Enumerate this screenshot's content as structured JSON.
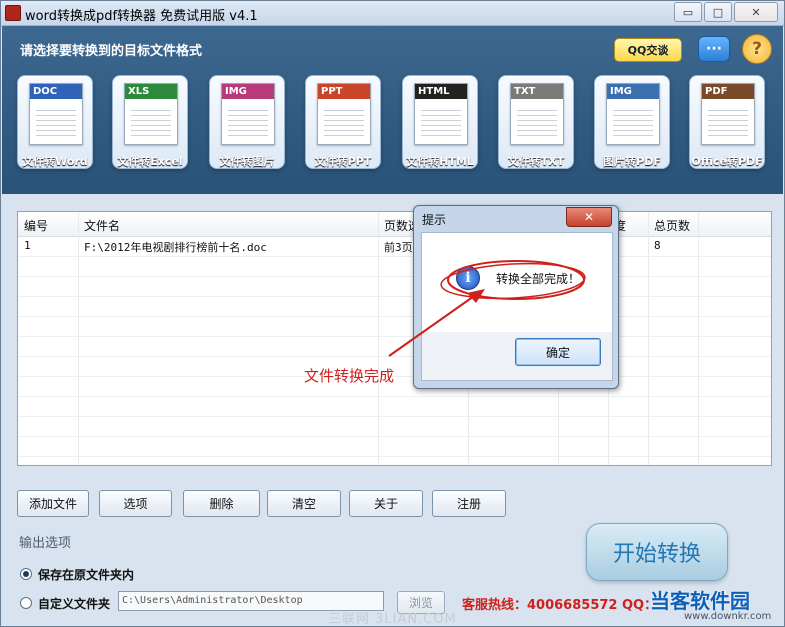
{
  "window": {
    "title": "word转换成pdf转换器 免费试用版 v4.1",
    "minimize_glyph": "▭",
    "maximize_glyph": "□",
    "close_glyph": "✕"
  },
  "top_panel": {
    "heading": "请选择要转换到的目标文件格式",
    "qq_label": "QQ交谈",
    "chat_glyph": "···",
    "help_glyph": "?"
  },
  "tools": [
    {
      "tag": "DOC",
      "label": "文件转Word",
      "icon": "word-doc-icon",
      "color": "#2f62b8"
    },
    {
      "tag": "XLS",
      "label": "文件转Excel",
      "icon": "excel-chart-icon",
      "color": "#2d8a3c"
    },
    {
      "tag": "IMG",
      "label": "文件转图片",
      "icon": "image-file-icon",
      "color": "#b83a7a"
    },
    {
      "tag": "PPT",
      "label": "文件转PPT",
      "icon": "ppt-file-icon",
      "color": "#c8452a"
    },
    {
      "tag": "HTML",
      "label": "文件转HTML",
      "icon": "html-globe-icon",
      "color": "#222222"
    },
    {
      "tag": "TXT",
      "label": "文件转TXT",
      "icon": "txt-file-icon",
      "color": "#7a7a7a"
    },
    {
      "tag": "IMG",
      "label": "图片转PDF",
      "icon": "image-to-pdf-icon",
      "color": "#3c6fb0"
    },
    {
      "tag": "PDF",
      "label": "Office转PDF",
      "icon": "pdf-file-icon",
      "color": "#7a4a2a"
    }
  ],
  "table": {
    "headers": [
      "编号",
      "文件名",
      "页数选",
      "",
      "",
      "",
      "度",
      "总页数"
    ],
    "rows": [
      {
        "id": "1",
        "file": "F:\\2012年电视剧排行榜前十名.doc",
        "pages_sel": "前3页",
        "progress": "",
        "total": "8"
      }
    ]
  },
  "buttons": {
    "add_file": "添加文件",
    "options": "选项",
    "delete": "删除",
    "clear": "清空",
    "about": "关于",
    "register": "注册"
  },
  "output": {
    "section_title": "输出选项",
    "option_keep": "保存在原文件夹内",
    "option_custom": "自定义文件夹",
    "custom_path": "C:\\Users\\Administrator\\Desktop",
    "browse": "浏览",
    "selected": "keep"
  },
  "start_button": "开始转换",
  "hotline": "客服热线：4006685572 QQ：",
  "dialog": {
    "title": "提示",
    "close_glyph": "✕",
    "icon_glyph": "i",
    "message": "转换全部完成！",
    "ok": "确定"
  },
  "annotation": "文件转换完成",
  "watermarks": {
    "site_name": "当客软件园",
    "site_url": "www.downkr.com",
    "faint": "三联网 3LIAN.COM"
  },
  "colors": {
    "panel": "#2f5a82",
    "accent_red": "#d0201b",
    "start_text": "#1f78b5"
  }
}
